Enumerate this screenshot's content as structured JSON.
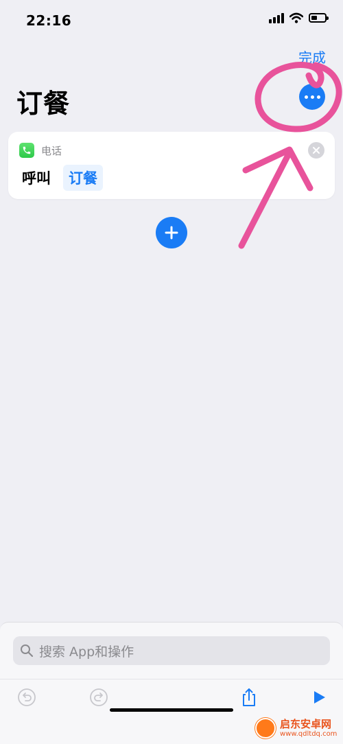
{
  "status_bar": {
    "time": "22:16"
  },
  "header": {
    "done_label": "完成",
    "title": "订餐"
  },
  "action_card": {
    "app_name": "电话",
    "verb": "呼叫",
    "contact": "订餐"
  },
  "bottom_panel": {
    "search_placeholder": "搜索 App和操作"
  },
  "watermark": {
    "title": "启东安卓网",
    "url": "www.qdltdq.com"
  },
  "colors": {
    "accent": "#1a7cf5",
    "phone_green": "#34c759",
    "annotation_pink": "#e8539b",
    "background": "#efeff4"
  },
  "icons": {
    "more": "ellipsis-icon",
    "phone": "phone-icon",
    "remove": "close-icon",
    "add": "plus-icon",
    "search": "search-icon",
    "undo": "undo-icon",
    "redo": "redo-icon",
    "share": "share-icon",
    "run": "play-icon"
  }
}
